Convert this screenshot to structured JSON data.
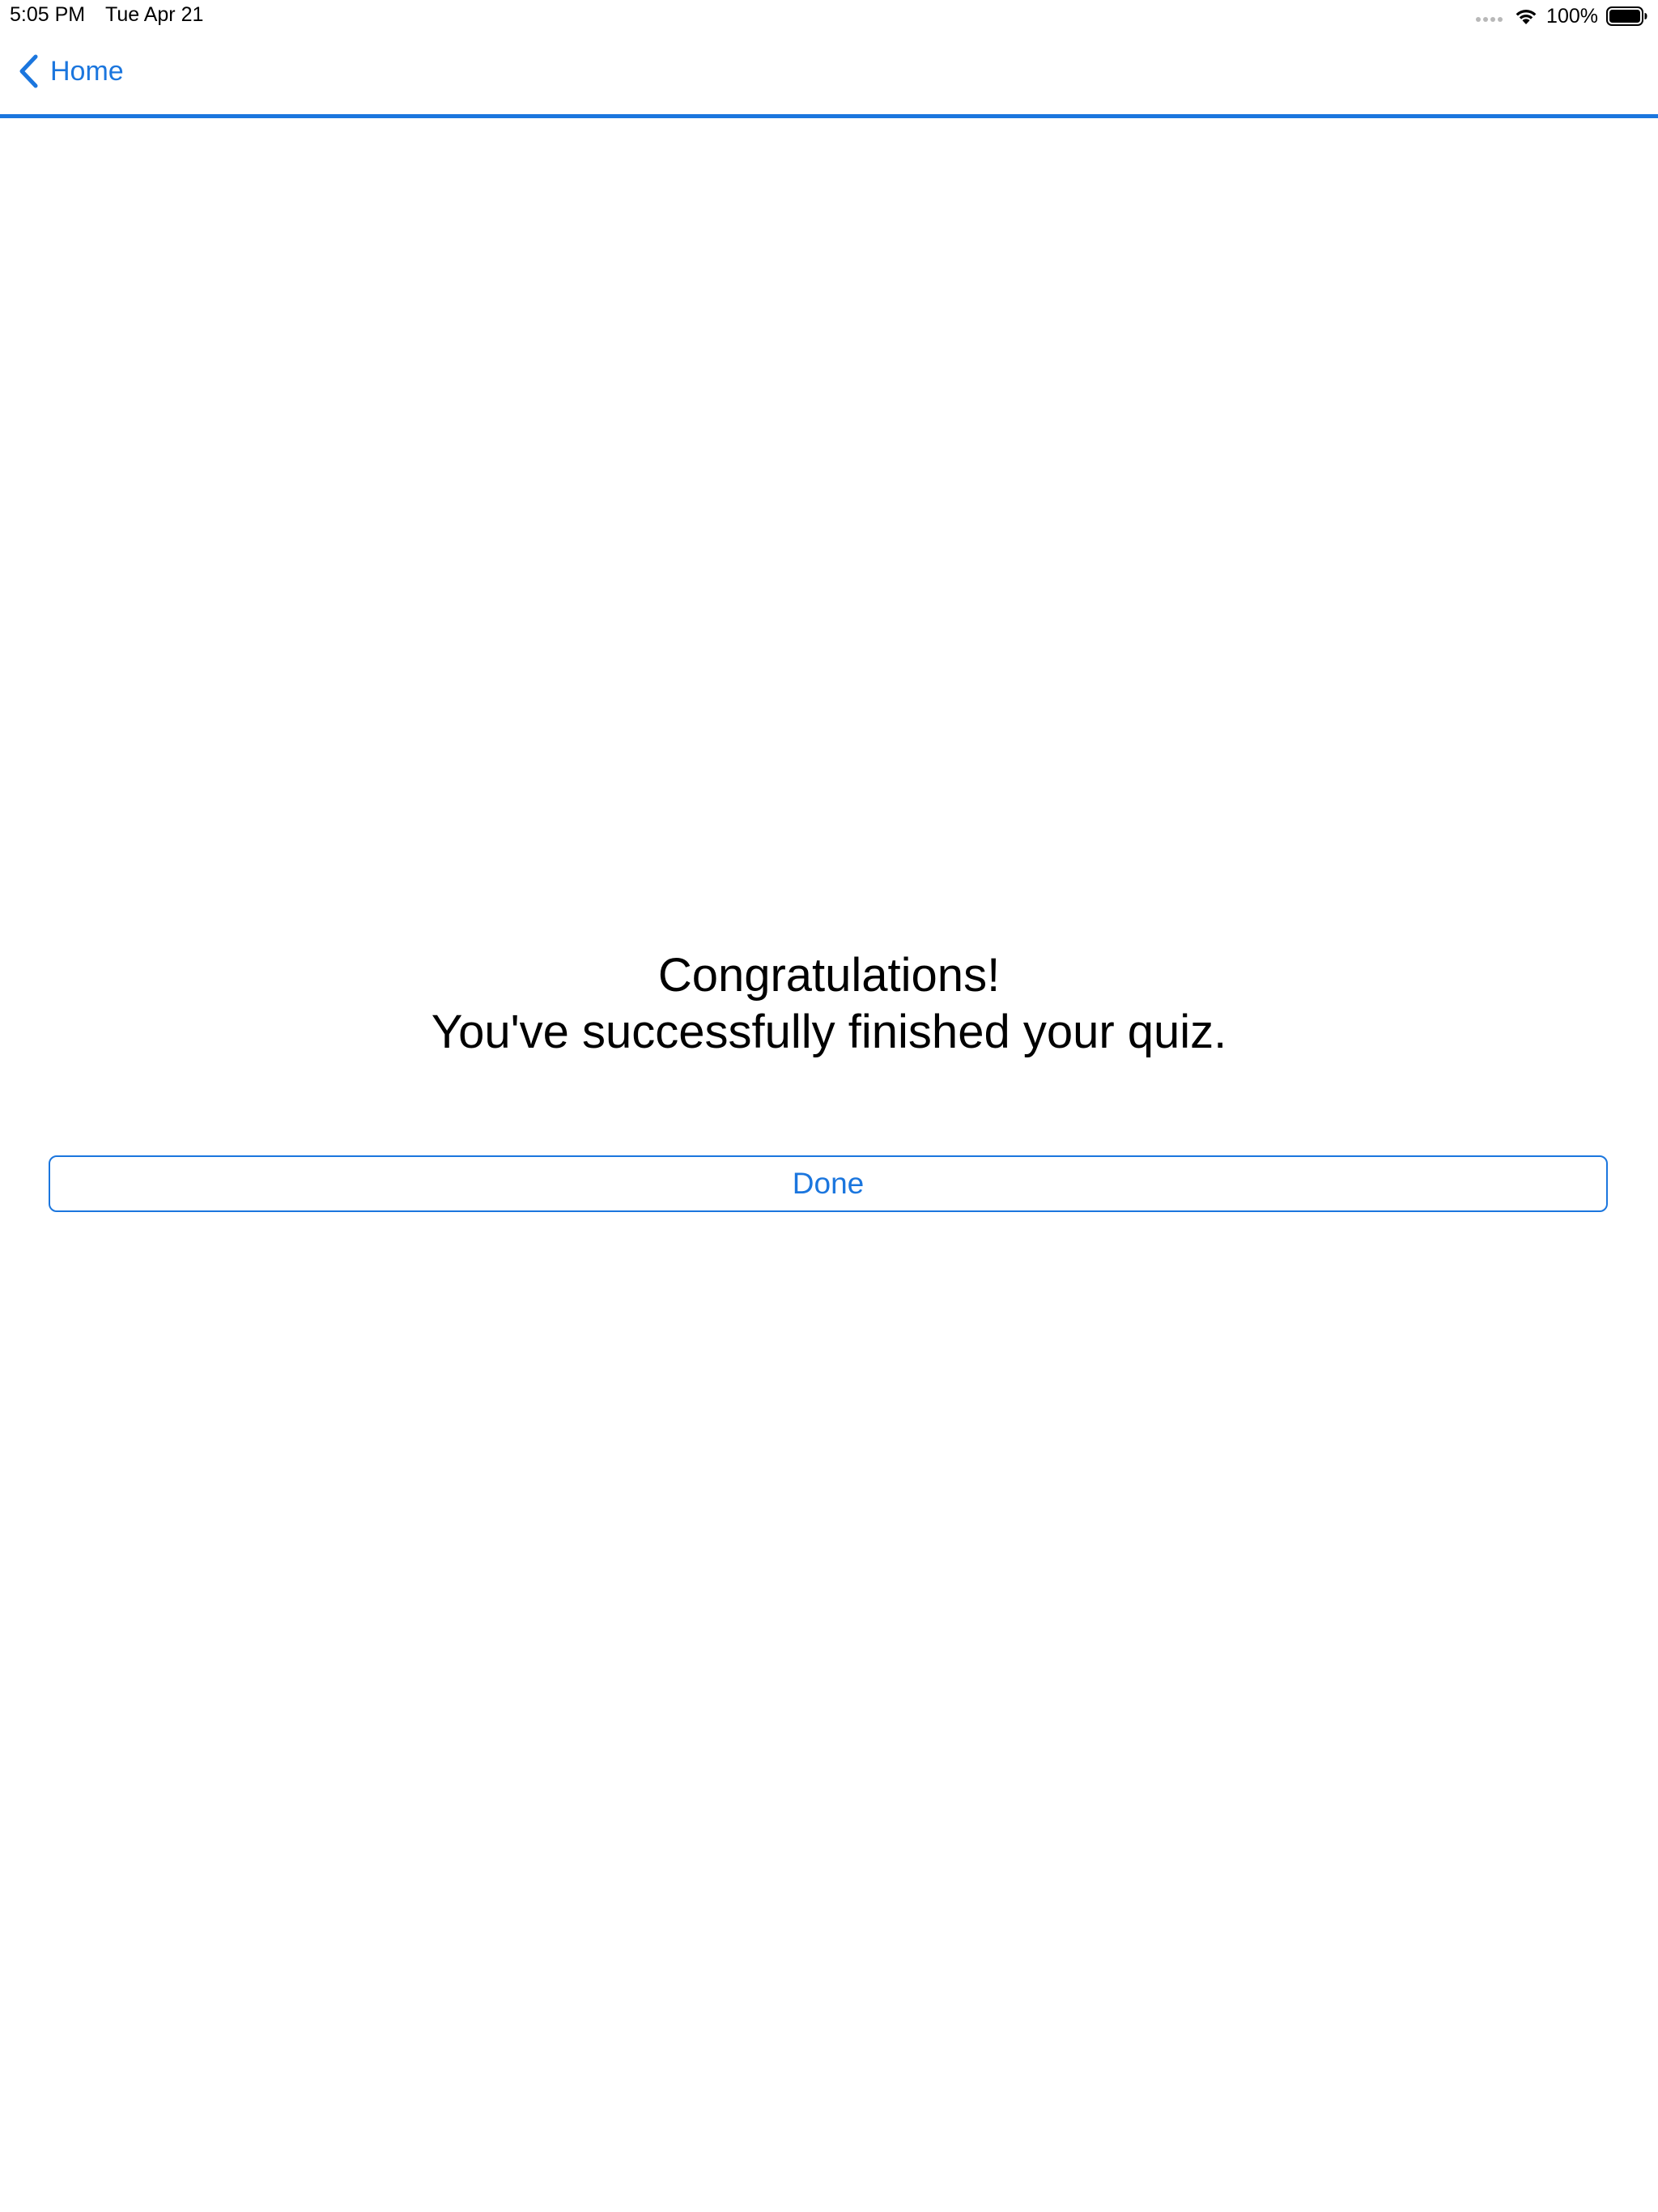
{
  "status_bar": {
    "time": "5:05 PM",
    "date": "Tue Apr 21",
    "battery_percent": "100%",
    "battery_level": 1.0
  },
  "nav": {
    "back_label": "Home"
  },
  "message": {
    "line1": "Congratulations!",
    "line2": "You've successfully finished your quiz."
  },
  "done_button": {
    "label": "Done"
  },
  "colors": {
    "accent": "#1b76de",
    "text": "#000000",
    "background": "#ffffff"
  },
  "icons": {
    "back": "chevron-left-icon",
    "wifi": "wifi-icon",
    "battery": "battery-icon",
    "signal": "signal-dots-icon"
  }
}
